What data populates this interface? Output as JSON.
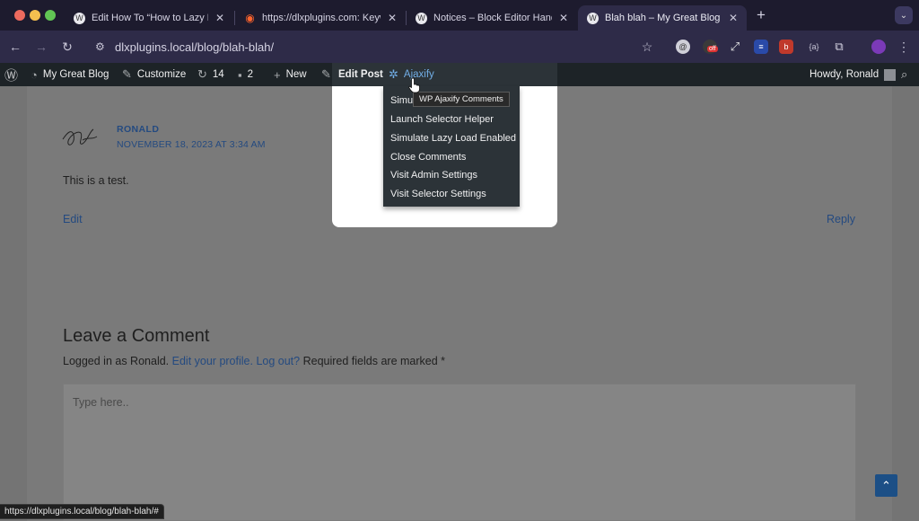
{
  "browser": {
    "tabs": [
      {
        "title": "Edit How To “How to Lazy Lo",
        "icon": "wordpress-icon",
        "active": false
      },
      {
        "title": "https://dlxplugins.com: Keyw",
        "icon": "semrush-icon",
        "active": false
      },
      {
        "title": "Notices – Block Editor Handb",
        "icon": "wordpress-icon",
        "active": false
      },
      {
        "title": "Blah blah – My Great Blog",
        "icon": "wordpress-icon",
        "active": true
      }
    ],
    "address": "dlxplugins.local/blog/blah-blah/",
    "extension_badge": "off",
    "extension_code": "{a}",
    "status_url": "https://dlxplugins.local/blog/blah-blah/#"
  },
  "adminbar": {
    "site_name": "My Great Blog",
    "customize": "Customize",
    "updates_count": "14",
    "comments_count": "2",
    "new_label": "New",
    "edit_post": "Edit Post",
    "ajaxify": "Ajaxify",
    "howdy": "Howdy, Ronald"
  },
  "ajaxify_menu": {
    "items": [
      "Simu",
      "Launch Selector Helper",
      "Simulate Lazy Load Enabled",
      "Close Comments",
      "Visit Admin Settings",
      "Visit Selector Settings"
    ],
    "tooltip": "WP Ajaxify Comments"
  },
  "comment": {
    "author": "RONALD",
    "date": "NOVEMBER 18, 2023 AT 3:34 AM",
    "text": "This is a test.",
    "edit_label": "Edit",
    "reply_label": "Reply"
  },
  "respond": {
    "title": "Leave a Comment",
    "logged_in_prefix": "Logged in as Ronald.",
    "edit_profile": "Edit your profile.",
    "log_out": "Log out?",
    "required_note": "Required fields are marked *",
    "placeholder": "Type here.."
  },
  "colors": {
    "link": "#244a80",
    "adminbar_bg": "#1d2327",
    "ajaxify_text": "#72aee6",
    "back_to_top": "#1c4f86"
  }
}
